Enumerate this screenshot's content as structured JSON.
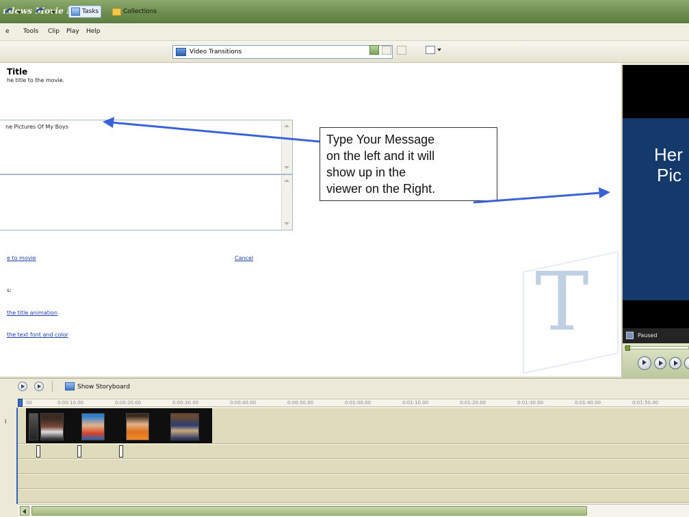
{
  "window": {
    "title": "ndows Movie Maker"
  },
  "menu": [
    "e",
    "Tools",
    "Clip",
    "Play",
    "Help"
  ],
  "toolbar": {
    "tasks_label": "Tasks",
    "collections_label": "Collections",
    "location_label": "Video Transitions"
  },
  "task_pane": {
    "title": "Title",
    "subtitle": "he title to the movie.",
    "text_value": "ne Pictures Of My Boys",
    "done_link": "e to movie",
    "cancel_link": "Cancel",
    "more_options_label": "s:",
    "option_animation": "the title animation",
    "option_font": "the text font and color"
  },
  "callout": {
    "lines": [
      "Type Your Message",
      "on the left and it will",
      "show up in the",
      "viewer on the Right."
    ]
  },
  "preview": {
    "line1": "Her",
    "line2": "Pic",
    "status": "Paused"
  },
  "timeline": {
    "show_storyboard_label": "Show Storyboard",
    "track_label": "l",
    "ruler_ticks": [
      "00",
      "0:00:10.00",
      "0:00:20.00",
      "0:00:30.00",
      "0:00:40.00",
      "0:00:50.00",
      "0:01:00.00",
      "0:01:10.00",
      "0:01:20.00",
      "0:01:30.00",
      "0:01:40.00",
      "0:01:50.00"
    ]
  },
  "colors": {
    "accent_arrow": "#3a62d8",
    "preview_bg": "#143a6c",
    "titlebar": "#6b8c4c"
  }
}
